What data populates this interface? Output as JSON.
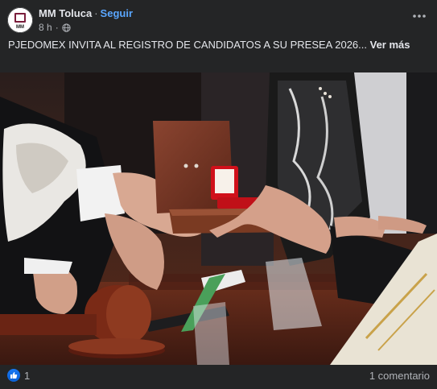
{
  "post": {
    "author": "MM Toluca",
    "separator": "·",
    "follow_label": "Seguir",
    "time": "8 h",
    "audience_icon": "globe-icon",
    "more_icon": "more-horizontal-icon",
    "avatar_text": "MM",
    "caption_text": "PJEDOMEX INVITA AL REGISTRO DE CANDIDATOS A SU PRESEA 2026...",
    "see_more_label": "Ver más",
    "photo_icon": "ceremony-photo",
    "reaction_icon": "like-icon",
    "reaction_count": "1",
    "comments_label": "1 comentario"
  },
  "colors": {
    "background": "#242526",
    "text_primary": "#e4e6eb",
    "text_secondary": "#b0b3b8",
    "link": "#5aa7ff",
    "like_blue": "#1877f2"
  }
}
